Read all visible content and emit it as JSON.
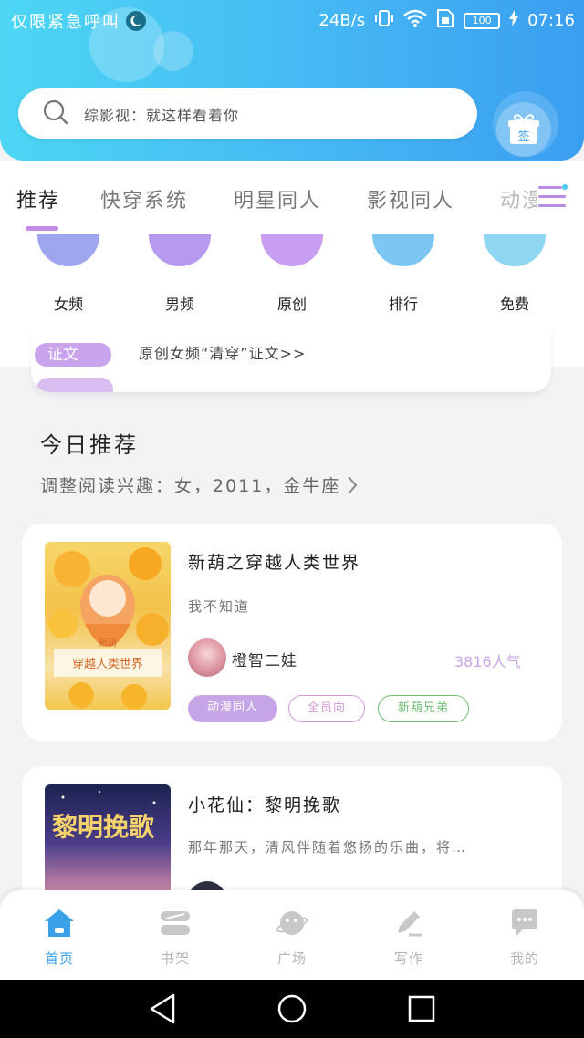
{
  "status_bar": {
    "left_text": "仅限紧急呼叫",
    "network_speed": "24B/s",
    "battery": "100",
    "battery_level": 1.0,
    "time": "07:16"
  },
  "search": {
    "placeholder": "综影视：就这样看着你"
  },
  "gift": {
    "label": "签"
  },
  "tabs": [
    {
      "label": "推荐",
      "active": true
    },
    {
      "label": "快穿系统",
      "active": false
    },
    {
      "label": "明星同人",
      "active": false
    },
    {
      "label": "影视同人",
      "active": false
    },
    {
      "label": "动漫",
      "active": false
    }
  ],
  "categories": [
    {
      "label": "女频",
      "color": "#9fa6f0"
    },
    {
      "label": "男频",
      "color": "#b79af0"
    },
    {
      "label": "原创",
      "color": "#c89ef2"
    },
    {
      "label": "排行",
      "color": "#7cc7f2"
    },
    {
      "label": "免费",
      "color": "#8fd6f2"
    }
  ],
  "notice": {
    "badge": "证文",
    "text": "原创女频“清穿”证文>>"
  },
  "recommend": {
    "title": "今日推荐",
    "subtitle": "调整阅读兴趣：女，2011，金牛座"
  },
  "books": [
    {
      "title": "新葫之穿越人类世界",
      "description": "我不知道",
      "author": "橙智二娃",
      "popularity": "3816人气",
      "cover_text_top": "新葫",
      "cover_text": "穿越人类世界",
      "tags": [
        {
          "label": "动漫同人",
          "style": "filled",
          "color": "#c6a5e6"
        },
        {
          "label": "全员向",
          "style": "outline",
          "color": "#d69ad6"
        },
        {
          "label": "新葫兄弟",
          "style": "outline",
          "color": "#6fbf73"
        }
      ]
    },
    {
      "title": "小花仙：黎明挽歌",
      "description": "那年那天，清风伴随着悠扬的乐曲，将…",
      "cover_text": "黎明挽歌"
    }
  ],
  "bottom_nav": [
    {
      "label": "首页",
      "icon": "home-icon",
      "active": true
    },
    {
      "label": "书架",
      "icon": "bookshelf-icon",
      "active": false
    },
    {
      "label": "广场",
      "icon": "planet-icon",
      "active": false
    },
    {
      "label": "写作",
      "icon": "pen-icon",
      "active": false
    },
    {
      "label": "我的",
      "icon": "chat-bubble-icon",
      "active": false
    }
  ],
  "colors": {
    "header_start": "#4dd6f4",
    "header_end": "#3a9ef0",
    "accent_purple": "#c28be6",
    "nav_active": "#3aa0e8"
  }
}
